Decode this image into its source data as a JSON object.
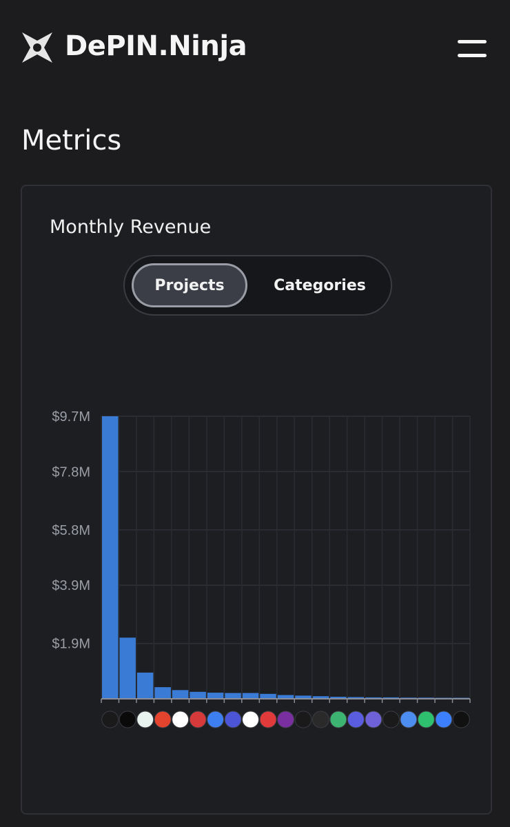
{
  "header": {
    "brand": "DePIN.Ninja"
  },
  "page": {
    "title": "Metrics"
  },
  "card": {
    "title": "Monthly Revenue",
    "tabs": [
      {
        "label": "Projects",
        "active": true
      },
      {
        "label": "Categories",
        "active": false
      }
    ]
  },
  "chart_data": {
    "type": "bar",
    "ylim": [
      0,
      9.7
    ],
    "yticks": [
      "$9.7M",
      "$7.8M",
      "$5.8M",
      "$3.9M",
      "$1.9M"
    ],
    "values": [
      9.7,
      2.1,
      0.9,
      0.4,
      0.3,
      0.24,
      0.21,
      0.2,
      0.2,
      0.17,
      0.13,
      0.11,
      0.09,
      0.07,
      0.06,
      0.05,
      0.05,
      0.04,
      0.04,
      0.03,
      0.02,
      0.01
    ],
    "bar_color": "#3a7bd5",
    "grid": true,
    "x_icon_colors": [
      "#1a1a1a",
      "#0a0a0a",
      "#e8f2ee",
      "#e4442e",
      "#ffffff",
      "#d63a3a",
      "#3d7ff0",
      "#4b55d6",
      "#ffffff",
      "#e03a3a",
      "#7a2fa0",
      "#1a1a1a",
      "#2a2a2a",
      "#3cb371",
      "#5a5de0",
      "#6f62d8",
      "#1a1a1a",
      "#4d8df0",
      "#2ec06e",
      "#3d80ff",
      "#111111"
    ]
  }
}
